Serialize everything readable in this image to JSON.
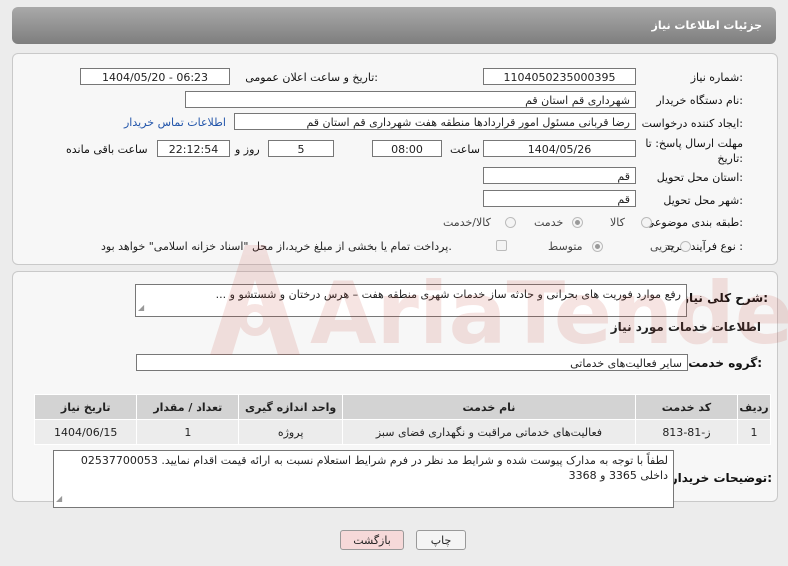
{
  "header": {
    "title": "جزئیات اطلاعات نیاز"
  },
  "fields": {
    "need_number_label": "شماره نیاز:",
    "need_number": "1104050235000395",
    "announce_label": "تاریخ و ساعت اعلان عمومی:",
    "announce_value": "1404/05/20 - 06:23",
    "buyer_org_label": "نام دستگاه خریدار:",
    "buyer_org": "شهرداری قم استان قم",
    "creator_label": "ایجاد کننده درخواست:",
    "creator": "رضا قربانی مسئول امور قراردادها منطقه هفت شهرداری قم استان قم",
    "contact_link": "اطلاعات تماس خریدار",
    "deadline_label_1": "مهلت ارسال پاسخ: تا",
    "deadline_label_2": "تاریخ:",
    "deadline_date": "1404/05/26",
    "time_label": "ساعت",
    "deadline_time": "08:00",
    "days_value": "5",
    "days_label": "روز و",
    "remaining_value": "22:12:54",
    "remaining_label": "ساعت باقی مانده",
    "province_label": "استان محل تحویل:",
    "province": "قم",
    "city_label": "شهر محل تحویل:",
    "city": "قم",
    "category_label": "طبقه بندی موضوعی:",
    "category_options": [
      "کالا",
      "خدمت",
      "کالا/خدمت"
    ],
    "category_selected": "خدمت",
    "process_label": "نوع فرآیند خرید :",
    "process_options": [
      "جزیی",
      "متوسط"
    ],
    "process_selected": "متوسط",
    "payment_note": "پرداخت تمام یا بخشی از مبلغ خرید،از محل \"اسناد خزانه اسلامی\" خواهد بود."
  },
  "summary": {
    "label": "شرح کلی نیاز:",
    "text": "رفع موارد فوریت های بحرانی و حادثه ساز خدمات شهری منطقه هفت – هرس درختان و شستشو و ..."
  },
  "services": {
    "section_title": "اطلاعات خدمات مورد نیاز",
    "group_label": "گروه خدمت:",
    "group_value": "سایر فعالیت‌های خدماتی",
    "columns": [
      "ردیف",
      "کد خدمت",
      "نام خدمت",
      "واحد اندازه گیری",
      "تعداد / مقدار",
      "تاریخ نیاز"
    ],
    "rows": [
      {
        "row": "1",
        "code": "ز-81-813",
        "name": "فعالیت‌های خدماتی مراقبت و نگهداری فضای سبز",
        "unit": "پروژه",
        "qty": "1",
        "date": "1404/06/15"
      }
    ]
  },
  "buyer_notes": {
    "label": "توضیحات خریدار:",
    "text": "لطفاً با توجه به مدارک پیوست شده و شرایط مد نظر در فرم شرایط استعلام نسبت به ارائه قیمت اقدام نمایید. 02537700053 داخلی 3365 و 3368"
  },
  "buttons": {
    "print": "چاپ",
    "back": "بازگشت"
  },
  "watermark": {
    "text": "AriaTender.neT"
  },
  "colors": {
    "header": "#8c8c8c",
    "link": "#2255aa",
    "back_button": "#f6d9d9",
    "table_header": "#d3d3d3"
  }
}
